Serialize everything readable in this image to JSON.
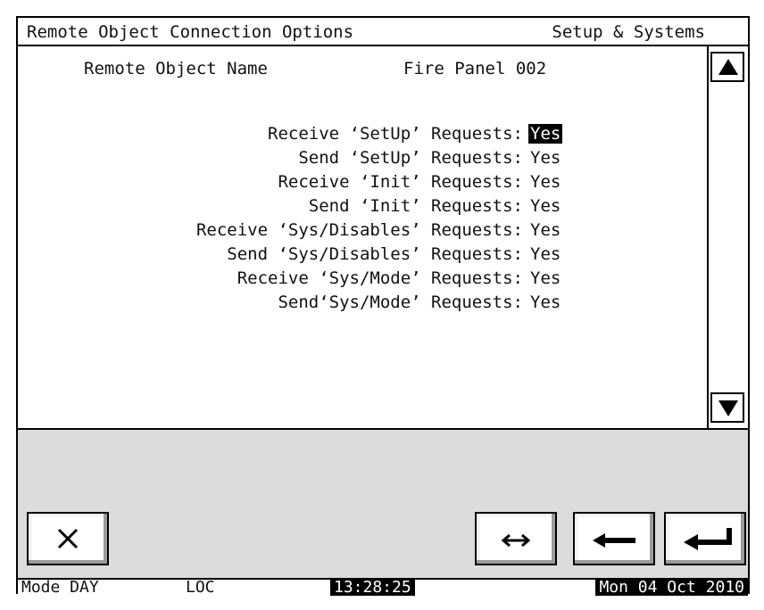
{
  "header": {
    "title": "Remote Object Connection Options",
    "section": "Setup & Systems"
  },
  "remote_object": {
    "label": "Remote Object Name",
    "value": "Fire Panel 002"
  },
  "options": [
    {
      "label": "Receive ‘SetUp’ Requests:",
      "value": "Yes",
      "selected": true
    },
    {
      "label": "Send ‘SetUp’ Requests:",
      "value": "Yes",
      "selected": false
    },
    {
      "label": "Receive ‘Init’ Requests:",
      "value": "Yes",
      "selected": false
    },
    {
      "label": "Send ‘Init’ Requests:",
      "value": "Yes",
      "selected": false
    },
    {
      "label": "Receive ‘Sys/Disables’ Requests:",
      "value": "Yes",
      "selected": false
    },
    {
      "label": "Send ‘Sys/Disables’ Requests:",
      "value": "Yes",
      "selected": false
    },
    {
      "label": "Receive ‘Sys/Mode’ Requests:",
      "value": "Yes",
      "selected": false
    },
    {
      "label": "Send‘Sys/Mode’ Requests:",
      "value": "Yes",
      "selected": false
    }
  ],
  "buttons": {
    "close_icon": "x-icon",
    "swap_icon": "left-right-arrow-icon",
    "back_icon": "left-arrow-icon",
    "enter_icon": "enter-return-icon"
  },
  "status": {
    "mode": "Mode DAY",
    "loc": "LOC",
    "time": "13:28:25",
    "date": "Mon 04 Oct 2010"
  },
  "colors": {
    "panel": "#dcdcdc",
    "highlight": "#000000"
  }
}
